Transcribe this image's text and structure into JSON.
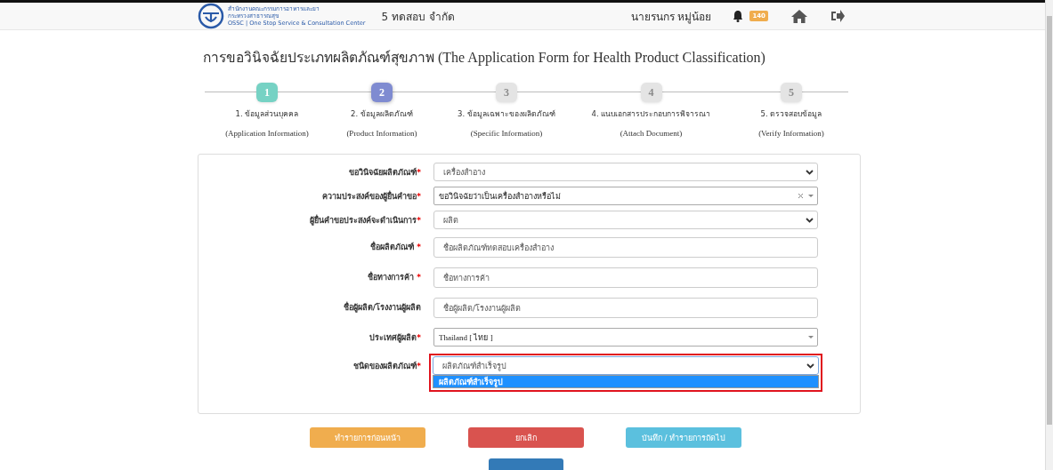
{
  "header": {
    "logo_text": [
      "สำนักงานคณะกรรมการอาหารและยา",
      "กระทรวงสาธารณสุข",
      "OSSC | One Stop Service & Consultation Center"
    ],
    "company": "5 ทดสอบ จำกัด",
    "user": "นายรนกร หมู่น้อย",
    "notification_count": "140"
  },
  "title": {
    "thai": "การขอวินิจฉัยประเภทผลิตภัณฑ์สุขภาพ",
    "english": "(The Application Form for Health Product Classification)"
  },
  "steps": [
    {
      "number": "1",
      "label": "1. ข้อมูลส่วนบุคคล",
      "sublabel": "(Application Information)",
      "completed": true,
      "selected": false
    },
    {
      "number": "2",
      "label": "2. ข้อมูลผลิตภัณฑ์",
      "sublabel": "(Product Information)",
      "completed": false,
      "selected": true
    },
    {
      "number": "3",
      "label": "3. ข้อมูลเฉพาะของผลิตภัณฑ์",
      "sublabel": "(Specific Information)",
      "completed": false,
      "selected": false
    },
    {
      "number": "4",
      "label": "4. แนบเอกสารประกอบการพิจารณา",
      "sublabel": "(Attach Document)",
      "completed": false,
      "selected": false
    },
    {
      "number": "5",
      "label": "5. ตรวจสอบข้อมูล",
      "sublabel": "(Verify Information)",
      "completed": false,
      "selected": false
    }
  ],
  "fields": [
    {
      "label": "ขอวินิจฉัยผลิตภัณฑ์",
      "required": "*",
      "kind": "select",
      "value": "เครื่องสำอาง"
    },
    {
      "label": "ความประสงค์ของผู้ยื่นคำขอ",
      "required": "*",
      "kind": "combo",
      "value": "ขอวินิจฉัยว่าเป็นเครื่องสำอางหรือไม่",
      "clearable": true
    },
    {
      "label": "ผู้ยื่นคำขอประสงค์จะดำเนินการ",
      "required": "*",
      "kind": "select",
      "value": "ผลิต"
    },
    {
      "label": "ชื่อผลิตภัณฑ์ ",
      "required": "*",
      "kind": "input",
      "value": "ชื่อผลิตภัณฑ์ทดสอบเครื่องสำอาง"
    },
    {
      "label": "ชื่อทางการค้า ",
      "required": "*",
      "kind": "input",
      "value": "ชื่อทางการค้า"
    },
    {
      "label": "ชื่อผู้ผลิต/โรงงานผู้ผลิต",
      "kind": "input",
      "value": "ชื่อผู้ผลิต/โรงงานผู้ผลิต"
    },
    {
      "label": "ประเทศผู้ผลิต",
      "required": "*",
      "kind": "combo",
      "value": "Thailand [ ไทย ]",
      "clearable": false
    },
    {
      "label": "ชนิดของผลิตภัณฑ์",
      "required": "*",
      "kind": "open-select",
      "value": "ผลิตภัณฑ์สำเร็จรูป",
      "highlighted": true,
      "options": [
        {
          "label": "ผลิตภัณฑ์สำเร็จรูป",
          "selected": true
        }
      ]
    }
  ],
  "buttons": [
    {
      "label": "ทำรายการก่อนหน้า",
      "kind": "warning"
    },
    {
      "label": "ยกเลิก",
      "kind": "danger"
    },
    {
      "label": "บันทึก / ทำรายการถัดไป",
      "kind": "info"
    },
    {
      "kind": "primary"
    }
  ]
}
